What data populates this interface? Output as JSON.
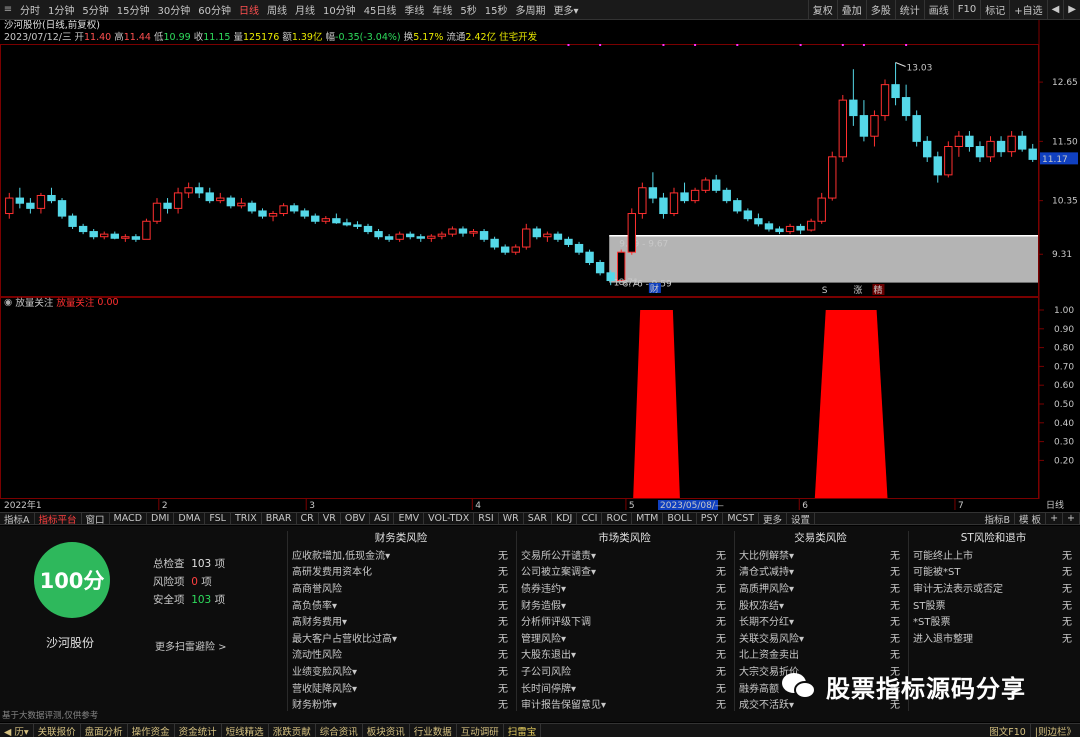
{
  "colors": {
    "up": "#ff3030",
    "down": "#55d8e8",
    "highlight": "#ff0000",
    "zone": "#b4b4b4",
    "accent_green": "#2eb85c"
  },
  "periods": [
    "分时",
    "1分钟",
    "5分钟",
    "15分钟",
    "30分钟",
    "60分钟",
    "日线",
    "周线",
    "月线",
    "10分钟",
    "45日线",
    "季线",
    "年线",
    "5秒",
    "15秒",
    "多周期",
    "更多▾"
  ],
  "active_period": "日线",
  "top_right_tools": [
    "复权",
    "叠加",
    "多股",
    "统计",
    "画线",
    "F10",
    "标记",
    "+自选",
    "◀",
    "▶"
  ],
  "title": {
    "stock": "沙河股份(日线,前复权)",
    "date": "2023/07/12/三",
    "open_label": "开",
    "open": "11.40",
    "high_label": "高",
    "high": "11.44",
    "low_label": "低",
    "low": "10.99",
    "close_label": "收",
    "close": "11.15",
    "vol_label": "量",
    "vol": "125176",
    "amt_label": "额",
    "amt": "1.39亿",
    "chg_label": "幅",
    "chg": "-0.35(-3.04%)",
    "turn_label": "换",
    "turn": "5.17%",
    "float_label": "流通",
    "float": "2.42亿",
    "industry": "住宅开发"
  },
  "price_axis": [
    "12.65",
    "11.50",
    "10.35",
    "9.31"
  ],
  "current_price": "11.17",
  "annotations": {
    "high": "13.03",
    "low": "8.71",
    "zone_upper": "9.59 - 9.67",
    "zone_lower": "8.76 - 9.59",
    "low_marker": "1",
    "cai": "财",
    "s_tag": "S",
    "zhang": "涨",
    "jing": "精"
  },
  "indicator": {
    "name": "放量关注",
    "series": "放量关注",
    "value": "0.00"
  },
  "ind_axis": [
    "1.00",
    "0.90",
    "0.80",
    "0.70",
    "0.60",
    "0.50",
    "0.40",
    "0.30",
    "0.20"
  ],
  "xaxis": {
    "start": "2022年1",
    "labels": [
      "2",
      "3",
      "4",
      "5",
      "6",
      "7"
    ],
    "cursor": "2023/05/08/—",
    "right": "日线"
  },
  "indicator_tabs": [
    "指标A",
    "指标平台",
    "窗口",
    "MACD",
    "DMI",
    "DMA",
    "FSL",
    "TRIX",
    "BRAR",
    "CR",
    "VR",
    "OBV",
    "ASI",
    "EMV",
    "VOL-TDX",
    "RSI",
    "WR",
    "SAR",
    "KDJ",
    "CCI",
    "ROC",
    "MTM",
    "BOLL",
    "PSY",
    "MCST",
    "更多",
    "设置"
  ],
  "indicator_tabs_right": [
    "指标B",
    "模 板",
    "+",
    "+"
  ],
  "score": {
    "value": "100分",
    "stock": "沙河股份",
    "total_label": "总检查",
    "total": "103",
    "unit": "项",
    "risk_label": "风险项",
    "risk": "0",
    "safe_label": "安全项",
    "safe": "103",
    "more": "更多扫雷避险 >",
    "note": "基于大数据评测,仅供参考"
  },
  "risk_columns": [
    {
      "title": "财务类风险",
      "rows": [
        [
          "应收款增加,低现金流▾",
          "无"
        ],
        [
          "高研发费用资本化",
          "无"
        ],
        [
          "高商誉风险",
          "无"
        ],
        [
          "高负债率▾",
          "无"
        ],
        [
          "高财务费用▾",
          "无"
        ],
        [
          "最大客户占营收比过高▾",
          "无"
        ],
        [
          "流动性风险",
          "无"
        ],
        [
          "业绩变脸风险▾",
          "无"
        ],
        [
          "营收陡降风险▾",
          "无"
        ],
        [
          "财务粉饰▾",
          "无"
        ]
      ]
    },
    {
      "title": "市场类风险",
      "rows": [
        [
          "交易所公开谴责▾",
          "无"
        ],
        [
          "公司被立案调查▾",
          "无"
        ],
        [
          "债券违约▾",
          "无"
        ],
        [
          "财务造假▾",
          "无"
        ],
        [
          "分析师评级下调",
          "无"
        ],
        [
          "管理风险▾",
          "无"
        ],
        [
          "大股东退出▾",
          "无"
        ],
        [
          "子公司风险",
          "无"
        ],
        [
          "长时间停牌▾",
          "无"
        ],
        [
          "审计报告保留意见▾",
          "无"
        ]
      ]
    },
    {
      "title": "交易类风险",
      "rows": [
        [
          "大比例解禁▾",
          "无"
        ],
        [
          "清仓式减持▾",
          "无"
        ],
        [
          "高质押风险▾",
          "无"
        ],
        [
          "股权冻结▾",
          "无"
        ],
        [
          "长期不分红▾",
          "无"
        ],
        [
          "关联交易风险▾",
          "无"
        ],
        [
          "北上资金卖出",
          "无"
        ],
        [
          "大宗交易折价",
          "无"
        ],
        [
          "融券高额",
          "无"
        ],
        [
          "成交不活跃▾",
          "无"
        ]
      ]
    },
    {
      "title": "ST风险和退市",
      "rows": [
        [
          "可能终止上市",
          "无"
        ],
        [
          "可能被*ST",
          "无"
        ],
        [
          "审计无法表示或否定",
          "无"
        ],
        [
          "ST股票",
          "无"
        ],
        [
          "*ST股票",
          "无"
        ],
        [
          "进入退市整理",
          "无"
        ]
      ]
    }
  ],
  "bottom_tabs": [
    "◀ 历▾",
    "关联报价",
    "盘面分析",
    "操作资金",
    "资金统计",
    "短线精选",
    "涨跌贡献",
    "综合资讯",
    "板块资讯",
    "行业数据",
    "互动调研",
    "扫雷宝"
  ],
  "bottom_right": "图文F10",
  "bottom_right2": "|则边栏》",
  "watermark": "股票指标源码分享",
  "candles": [
    [
      10.1,
      10.5,
      10.0,
      10.4
    ],
    [
      10.4,
      10.6,
      10.2,
      10.3
    ],
    [
      10.3,
      10.4,
      10.1,
      10.2
    ],
    [
      10.2,
      10.5,
      10.1,
      10.45
    ],
    [
      10.45,
      10.6,
      10.3,
      10.35
    ],
    [
      10.35,
      10.4,
      10.0,
      10.05
    ],
    [
      10.05,
      10.1,
      9.8,
      9.85
    ],
    [
      9.85,
      9.9,
      9.7,
      9.75
    ],
    [
      9.75,
      9.8,
      9.6,
      9.65
    ],
    [
      9.65,
      9.75,
      9.6,
      9.7
    ],
    [
      9.7,
      9.75,
      9.6,
      9.62
    ],
    [
      9.62,
      9.7,
      9.55,
      9.65
    ],
    [
      9.65,
      9.7,
      9.55,
      9.6
    ],
    [
      9.6,
      10.0,
      9.6,
      9.95
    ],
    [
      9.95,
      10.4,
      9.9,
      10.3
    ],
    [
      10.3,
      10.4,
      10.1,
      10.2
    ],
    [
      10.2,
      10.6,
      10.1,
      10.5
    ],
    [
      10.5,
      10.7,
      10.4,
      10.6
    ],
    [
      10.6,
      10.7,
      10.4,
      10.5
    ],
    [
      10.5,
      10.6,
      10.3,
      10.35
    ],
    [
      10.35,
      10.5,
      10.3,
      10.4
    ],
    [
      10.4,
      10.45,
      10.2,
      10.25
    ],
    [
      10.25,
      10.4,
      10.2,
      10.3
    ],
    [
      10.3,
      10.35,
      10.1,
      10.15
    ],
    [
      10.15,
      10.2,
      10.0,
      10.05
    ],
    [
      10.05,
      10.15,
      9.95,
      10.1
    ],
    [
      10.1,
      10.3,
      10.05,
      10.25
    ],
    [
      10.25,
      10.3,
      10.1,
      10.15
    ],
    [
      10.15,
      10.2,
      10.0,
      10.05
    ],
    [
      10.05,
      10.1,
      9.9,
      9.95
    ],
    [
      9.95,
      10.05,
      9.9,
      10.0
    ],
    [
      10.0,
      10.1,
      9.9,
      9.92
    ],
    [
      9.92,
      10.0,
      9.85,
      9.88
    ],
    [
      9.88,
      9.95,
      9.8,
      9.85
    ],
    [
      9.85,
      9.9,
      9.7,
      9.75
    ],
    [
      9.75,
      9.8,
      9.6,
      9.65
    ],
    [
      9.65,
      9.7,
      9.55,
      9.6
    ],
    [
      9.6,
      9.75,
      9.55,
      9.7
    ],
    [
      9.7,
      9.75,
      9.6,
      9.65
    ],
    [
      9.65,
      9.7,
      9.55,
      9.62
    ],
    [
      9.62,
      9.7,
      9.55,
      9.66
    ],
    [
      9.66,
      9.75,
      9.6,
      9.7
    ],
    [
      9.7,
      9.85,
      9.65,
      9.8
    ],
    [
      9.8,
      9.85,
      9.65,
      9.72
    ],
    [
      9.72,
      9.8,
      9.65,
      9.75
    ],
    [
      9.75,
      9.8,
      9.55,
      9.6
    ],
    [
      9.6,
      9.65,
      9.4,
      9.45
    ],
    [
      9.45,
      9.5,
      9.3,
      9.35
    ],
    [
      9.35,
      9.5,
      9.3,
      9.45
    ],
    [
      9.45,
      9.9,
      9.4,
      9.8
    ],
    [
      9.8,
      9.85,
      9.6,
      9.65
    ],
    [
      9.65,
      9.75,
      9.55,
      9.7
    ],
    [
      9.7,
      9.75,
      9.55,
      9.6
    ],
    [
      9.6,
      9.65,
      9.45,
      9.5
    ],
    [
      9.5,
      9.55,
      9.3,
      9.35
    ],
    [
      9.35,
      9.4,
      9.1,
      9.15
    ],
    [
      9.15,
      9.2,
      8.9,
      8.95
    ],
    [
      8.95,
      9.0,
      8.71,
      8.8
    ],
    [
      8.8,
      9.4,
      8.8,
      9.35
    ],
    [
      9.35,
      10.2,
      9.3,
      10.1
    ],
    [
      10.1,
      10.7,
      10.0,
      10.6
    ],
    [
      10.6,
      10.9,
      10.3,
      10.4
    ],
    [
      10.4,
      10.5,
      10.0,
      10.1
    ],
    [
      10.1,
      10.6,
      10.05,
      10.5
    ],
    [
      10.5,
      10.7,
      10.3,
      10.35
    ],
    [
      10.35,
      10.6,
      10.3,
      10.55
    ],
    [
      10.55,
      10.8,
      10.5,
      10.75
    ],
    [
      10.75,
      10.85,
      10.5,
      10.55
    ],
    [
      10.55,
      10.6,
      10.3,
      10.35
    ],
    [
      10.35,
      10.4,
      10.1,
      10.15
    ],
    [
      10.15,
      10.2,
      9.95,
      10.0
    ],
    [
      10.0,
      10.1,
      9.85,
      9.9
    ],
    [
      9.9,
      9.95,
      9.75,
      9.8
    ],
    [
      9.8,
      9.85,
      9.7,
      9.75
    ],
    [
      9.75,
      9.9,
      9.7,
      9.85
    ],
    [
      9.85,
      9.9,
      9.7,
      9.78
    ],
    [
      9.78,
      10.0,
      9.75,
      9.95
    ],
    [
      9.95,
      10.5,
      9.9,
      10.4
    ],
    [
      10.4,
      11.3,
      10.35,
      11.2
    ],
    [
      11.2,
      12.4,
      11.1,
      12.3
    ],
    [
      12.3,
      12.9,
      11.8,
      12.0
    ],
    [
      12.0,
      12.3,
      11.5,
      11.6
    ],
    [
      11.6,
      12.1,
      11.4,
      12.0
    ],
    [
      12.0,
      12.7,
      11.9,
      12.6
    ],
    [
      12.6,
      13.03,
      12.2,
      12.35
    ],
    [
      12.35,
      12.6,
      11.9,
      12.0
    ],
    [
      12.0,
      12.1,
      11.4,
      11.5
    ],
    [
      11.5,
      11.6,
      11.1,
      11.2
    ],
    [
      11.2,
      11.3,
      10.7,
      10.85
    ],
    [
      10.85,
      11.5,
      10.8,
      11.4
    ],
    [
      11.4,
      11.7,
      11.2,
      11.6
    ],
    [
      11.6,
      11.7,
      11.3,
      11.4
    ],
    [
      11.4,
      11.5,
      11.1,
      11.2
    ],
    [
      11.2,
      11.6,
      11.1,
      11.5
    ],
    [
      11.5,
      11.6,
      11.2,
      11.3
    ],
    [
      11.3,
      11.7,
      11.2,
      11.6
    ],
    [
      11.6,
      11.7,
      11.3,
      11.35
    ],
    [
      11.35,
      11.45,
      11.1,
      11.15
    ]
  ],
  "signals": [
    {
      "start": 0.61,
      "end": 0.655,
      "value": 1.0
    },
    {
      "start": 0.785,
      "end": 0.855,
      "value": 1.0
    }
  ]
}
